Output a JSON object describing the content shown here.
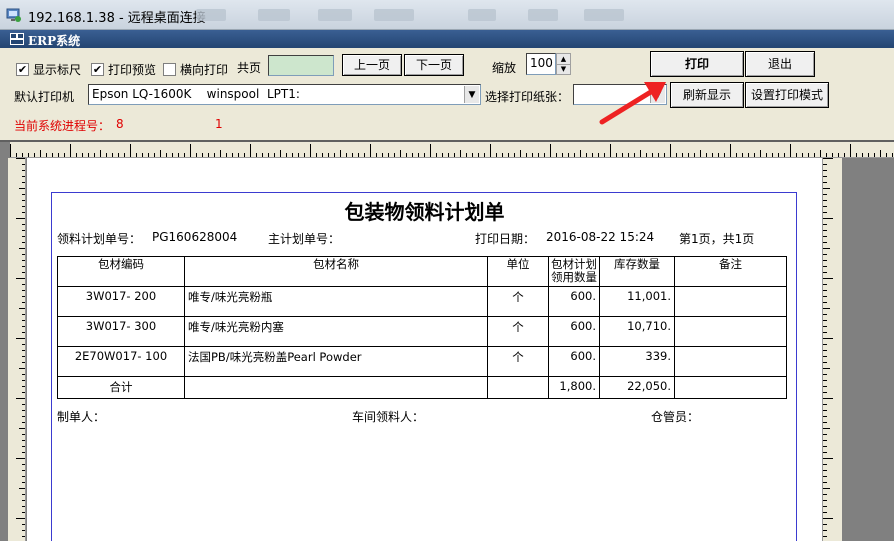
{
  "remote_window": {
    "title": "192.168.1.38 - 远程桌面连接"
  },
  "app": {
    "title": "ERP系统"
  },
  "toolbar": {
    "show_ruler": {
      "label": "显示标尺",
      "checked": true
    },
    "print_preview": {
      "label": "打印预览",
      "checked": true
    },
    "landscape": {
      "label": "横向打印",
      "checked": false
    },
    "total_pages_label": "共页",
    "total_pages_value": "",
    "prev_page": "上一页",
    "next_page": "下一页",
    "zoom_label": "缩放",
    "zoom_value": "100",
    "print_button": "打印",
    "exit_button": "退出",
    "default_printer_label": "默认打印机",
    "default_printer_value": "Epson LQ-1600K    winspool  LPT1:",
    "paper_label": "选择打印纸张：",
    "paper_value": "",
    "refresh_button": "刷新显示",
    "print_mode_button": "设置打印模式",
    "process_label": "当前系统进程号：",
    "process_value": "8",
    "process_value2": "1"
  },
  "document": {
    "title": "包装物领料计划单",
    "plan_no_label": "领料计划单号：",
    "plan_no": "PG160628004",
    "main_plan_label": "主计划单号：",
    "main_plan": "",
    "print_date_label": "打印日期：",
    "print_date": "2016-08-22 15:24",
    "page_info": "第1页，共1页",
    "columns": {
      "code": "包材编码",
      "name": "包材名称",
      "unit": "单位",
      "qty_line1": "包材计划",
      "qty_line2": "领用数量",
      "stock": "库存数量",
      "note": "备注"
    },
    "rows": [
      {
        "code": "3W017- 200",
        "name": "唯专/味光亮粉瓶",
        "unit": "个",
        "qty": "600.",
        "stock": "11,001.",
        "note": ""
      },
      {
        "code": "3W017- 300",
        "name": "唯专/味光亮粉内塞",
        "unit": "个",
        "qty": "600.",
        "stock": "10,710.",
        "note": ""
      },
      {
        "code": "2E70W017- 100",
        "name": "法国PB/味光亮粉盖Pearl Powder",
        "unit": "个",
        "qty": "600.",
        "stock": "339.",
        "note": ""
      }
    ],
    "total": {
      "label": "合计",
      "qty": "1,800.",
      "stock": "22,050."
    },
    "signatures": {
      "maker": "制单人：",
      "workshop": "车间领料人：",
      "warehouse": "仓管员："
    }
  },
  "colors": {
    "accent_red": "#e00000",
    "erp_caption": "#234572",
    "page_border": "#3b3bd0"
  }
}
